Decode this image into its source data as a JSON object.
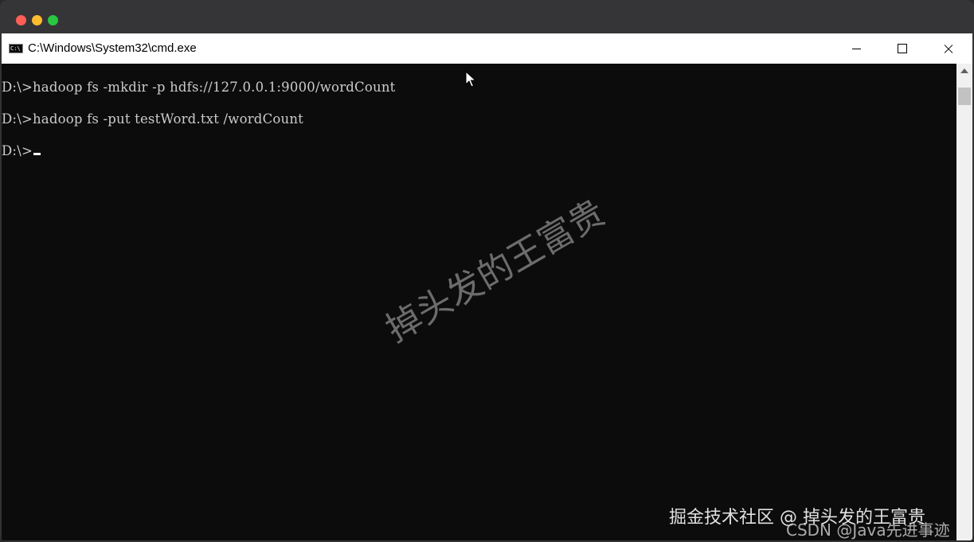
{
  "window": {
    "title": "C:\\Windows\\System32\\cmd.exe",
    "icon": "cmd-icon",
    "icon_text": "C:\\"
  },
  "console": {
    "lines": [
      "D:\\>hadoop fs -mkdir -p hdfs://127.0.0.1:9000/wordCount",
      "D:\\>hadoop fs -put testWord.txt /wordCount",
      "D:\\>"
    ]
  },
  "watermarks": {
    "center": "掉头发的王富贵",
    "juejin": "掘金技术社区 @ 掉头发的王富贵",
    "csdn": "CSDN @Java先进事迹"
  },
  "colors": {
    "console_bg": "#0c0c0c",
    "console_text": "#cccccc",
    "close_red": "#ff5f57",
    "minimize_yellow": "#febc2e",
    "zoom_green": "#28c840"
  }
}
